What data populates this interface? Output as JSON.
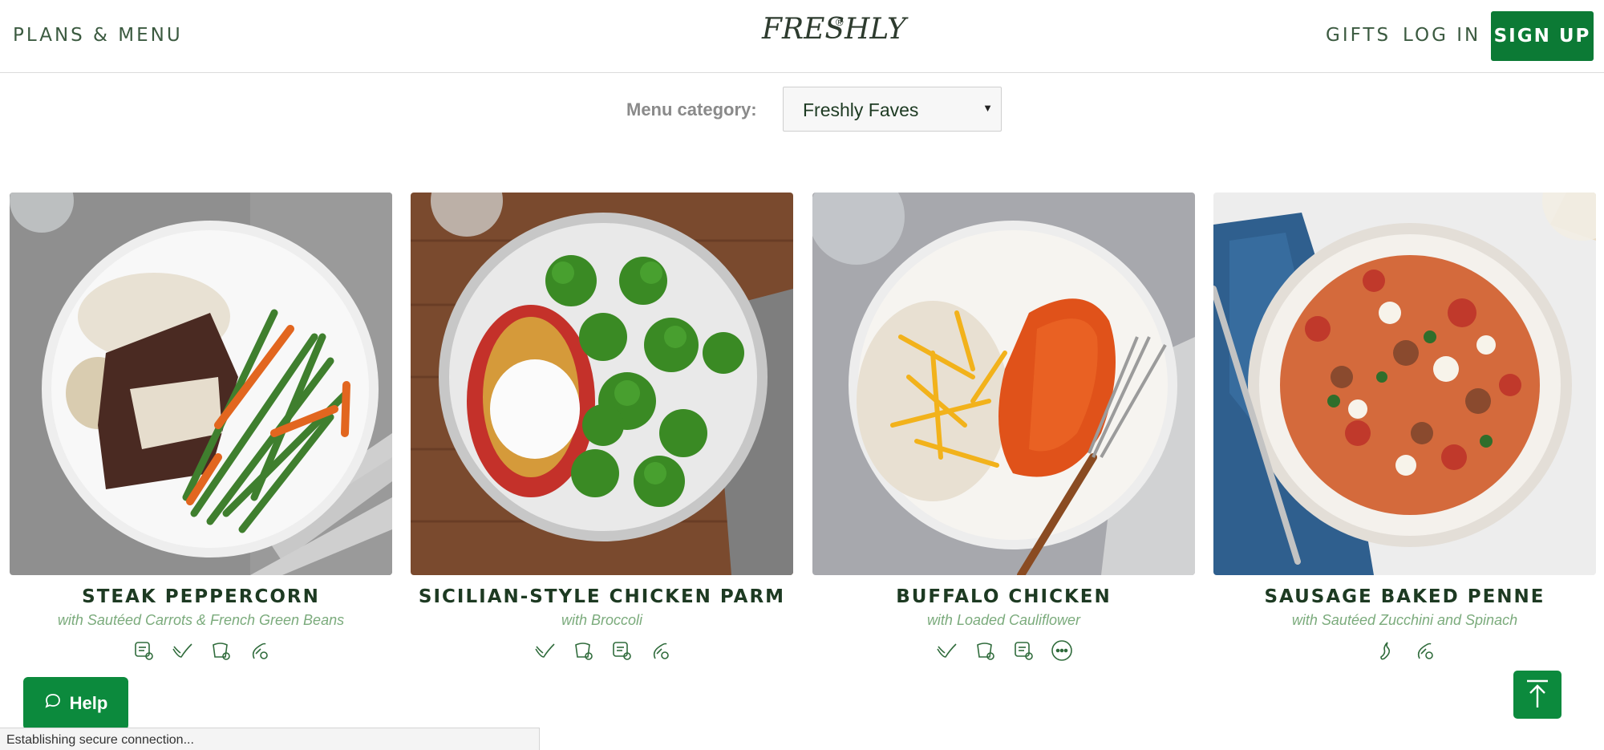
{
  "header": {
    "plans_menu": "PLANS & MENU",
    "logo": "FRESHLY",
    "logo_mark": "®",
    "gifts": "GIFTS",
    "login": "LOG IN",
    "signup": "SIGN UP"
  },
  "filter": {
    "label": "Menu category:",
    "selected": "Freshly Faves"
  },
  "meals": [
    {
      "title": "STEAK PEPPERCORN",
      "subtitle": "with Sautéed Carrots & French Green Beans",
      "icons": [
        "calorie-smart-icon",
        "gluten-free-icon",
        "soy-free-icon",
        "peanut-free-icon"
      ]
    },
    {
      "title": "SICILIAN-STYLE CHICKEN PARM",
      "subtitle": "with Broccoli",
      "icons": [
        "gluten-free-icon",
        "soy-free-icon",
        "calorie-smart-icon",
        "peanut-free-icon"
      ]
    },
    {
      "title": "BUFFALO CHICKEN",
      "subtitle": "with Loaded Cauliflower",
      "icons": [
        "gluten-free-icon",
        "soy-free-icon",
        "calorie-smart-icon",
        "more-icon"
      ]
    },
    {
      "title": "SAUSAGE BAKED PENNE",
      "subtitle": "with Sautéed Zucchini and Spinach",
      "icons": [
        "spicy-icon",
        "peanut-free-icon"
      ]
    }
  ],
  "help": {
    "label": "Help"
  },
  "status_bar": {
    "text": "Establishing secure connection..."
  },
  "colors": {
    "brand_green": "#0c7a35",
    "subtitle_green": "#7bab7c",
    "title_dark_green": "#1d3a22"
  }
}
